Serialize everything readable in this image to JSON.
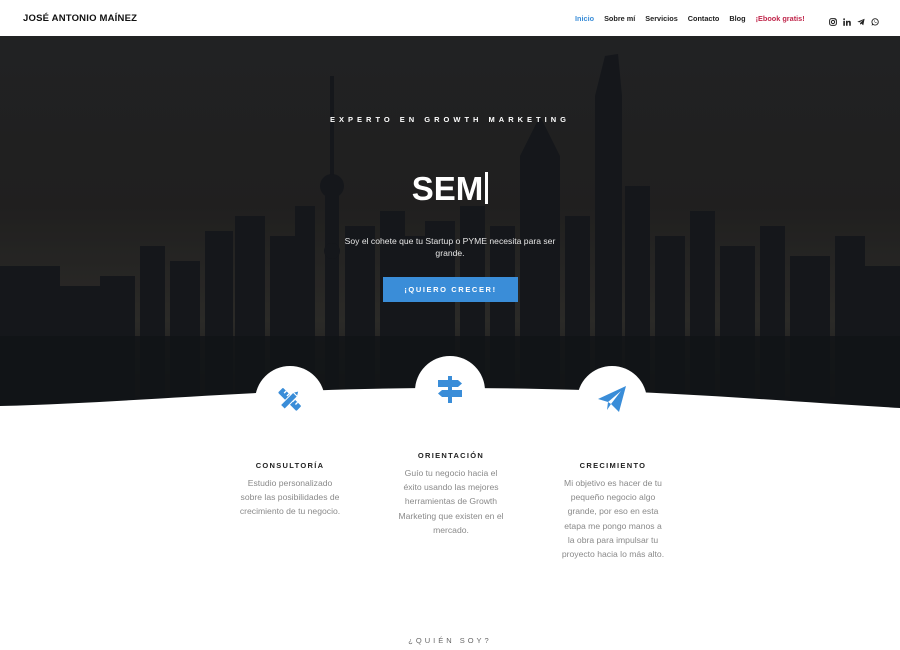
{
  "header": {
    "brand": "JOSÉ ANTONIO MAÍNEZ",
    "nav": [
      {
        "label": "Inicio",
        "active": true
      },
      {
        "label": "Sobre mí"
      },
      {
        "label": "Servicios"
      },
      {
        "label": "Contacto"
      },
      {
        "label": "Blog"
      },
      {
        "label": "¡Ebook gratis!"
      }
    ],
    "social": [
      "instagram-icon",
      "linkedin-icon",
      "telegram-icon",
      "whatsapp-icon"
    ]
  },
  "hero": {
    "eyebrow": "EXPERTO EN GROWTH MARKETING",
    "title": "SEM",
    "subtitle": "Soy el cohete que tu Startup o PYME necesita para ser grande.",
    "cta": "¡QUIERO CRECER!"
  },
  "features": [
    {
      "icon": "pencil-ruler-icon",
      "title": "CONSULTORÍA",
      "text": "Estudio personalizado sobre las posibilidades de crecimiento de tu negocio."
    },
    {
      "icon": "signpost-icon",
      "title": "ORIENTACIÓN",
      "text": "Guío tu negocio hacia el éxito usando las mejores herramientas de Growth Marketing que existen en el mercado."
    },
    {
      "icon": "paper-plane-icon",
      "title": "CRECIMIENTO",
      "text": "Mi objetivo es hacer de tu pequeño negocio algo grande, por eso en esta etapa me pongo manos a la obra para impulsar tu proyecto hacia lo más alto."
    }
  ],
  "next_section": {
    "label": "¿QUIÉN SOY?"
  },
  "colors": {
    "accent": "#3a8dd8",
    "ebook": "#c0264b"
  }
}
